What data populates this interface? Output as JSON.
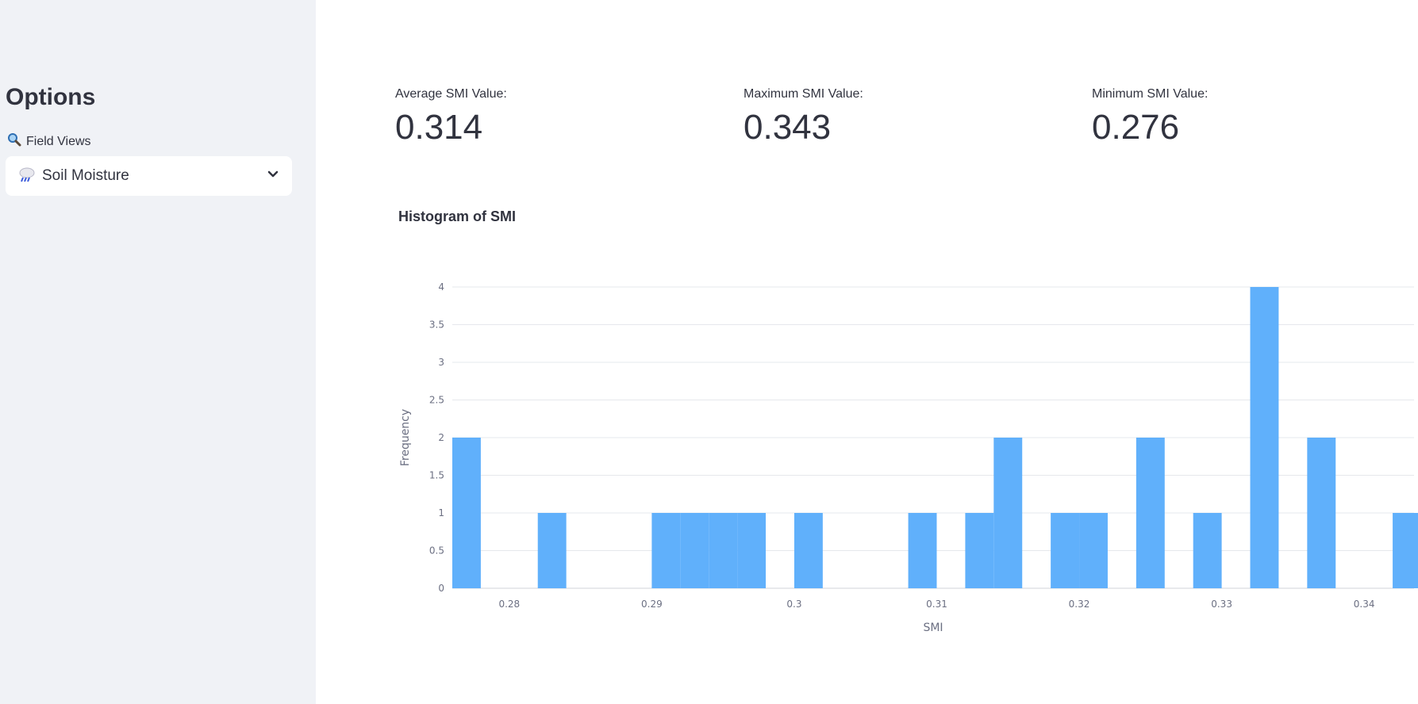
{
  "sidebar": {
    "title": "Options",
    "field_views_label": "Field Views",
    "field_views_icon": "magnifier-icon",
    "select_value": "Soil Moisture",
    "select_icon": "rain-cloud-icon"
  },
  "metrics": [
    {
      "label": "Average SMI Value:",
      "value": "0.314"
    },
    {
      "label": "Maximum SMI Value:",
      "value": "0.343"
    },
    {
      "label": "Minimum SMI Value:",
      "value": "0.276"
    }
  ],
  "colors": {
    "sidebar_bg": "#f0f2f6",
    "bar": "#60b0fb",
    "text": "#31333f"
  },
  "chart_data": {
    "type": "bar",
    "title": "Histogram of SMI",
    "xlabel": "SMI",
    "ylabel": "Frequency",
    "x_range": [
      0.276,
      0.3435
    ],
    "y_range": [
      0,
      4
    ],
    "bin_width": 0.002,
    "x_ticks": [
      "0.28",
      "0.29",
      "0.3",
      "0.31",
      "0.32",
      "0.33",
      "0.34"
    ],
    "y_ticks": [
      "0",
      "0.5",
      "1",
      "1.5",
      "2",
      "2.5",
      "3",
      "3.5",
      "4"
    ],
    "bins": [
      {
        "start": 0.276,
        "count": 2
      },
      {
        "start": 0.282,
        "count": 1
      },
      {
        "start": 0.29,
        "count": 1
      },
      {
        "start": 0.292,
        "count": 1
      },
      {
        "start": 0.294,
        "count": 1
      },
      {
        "start": 0.296,
        "count": 1
      },
      {
        "start": 0.3,
        "count": 1
      },
      {
        "start": 0.308,
        "count": 1
      },
      {
        "start": 0.312,
        "count": 1
      },
      {
        "start": 0.314,
        "count": 2
      },
      {
        "start": 0.318,
        "count": 1
      },
      {
        "start": 0.32,
        "count": 1
      },
      {
        "start": 0.324,
        "count": 2
      },
      {
        "start": 0.328,
        "count": 1
      },
      {
        "start": 0.332,
        "count": 4
      },
      {
        "start": 0.336,
        "count": 2
      },
      {
        "start": 0.342,
        "count": 1
      }
    ],
    "grid": true,
    "legend": "none"
  }
}
